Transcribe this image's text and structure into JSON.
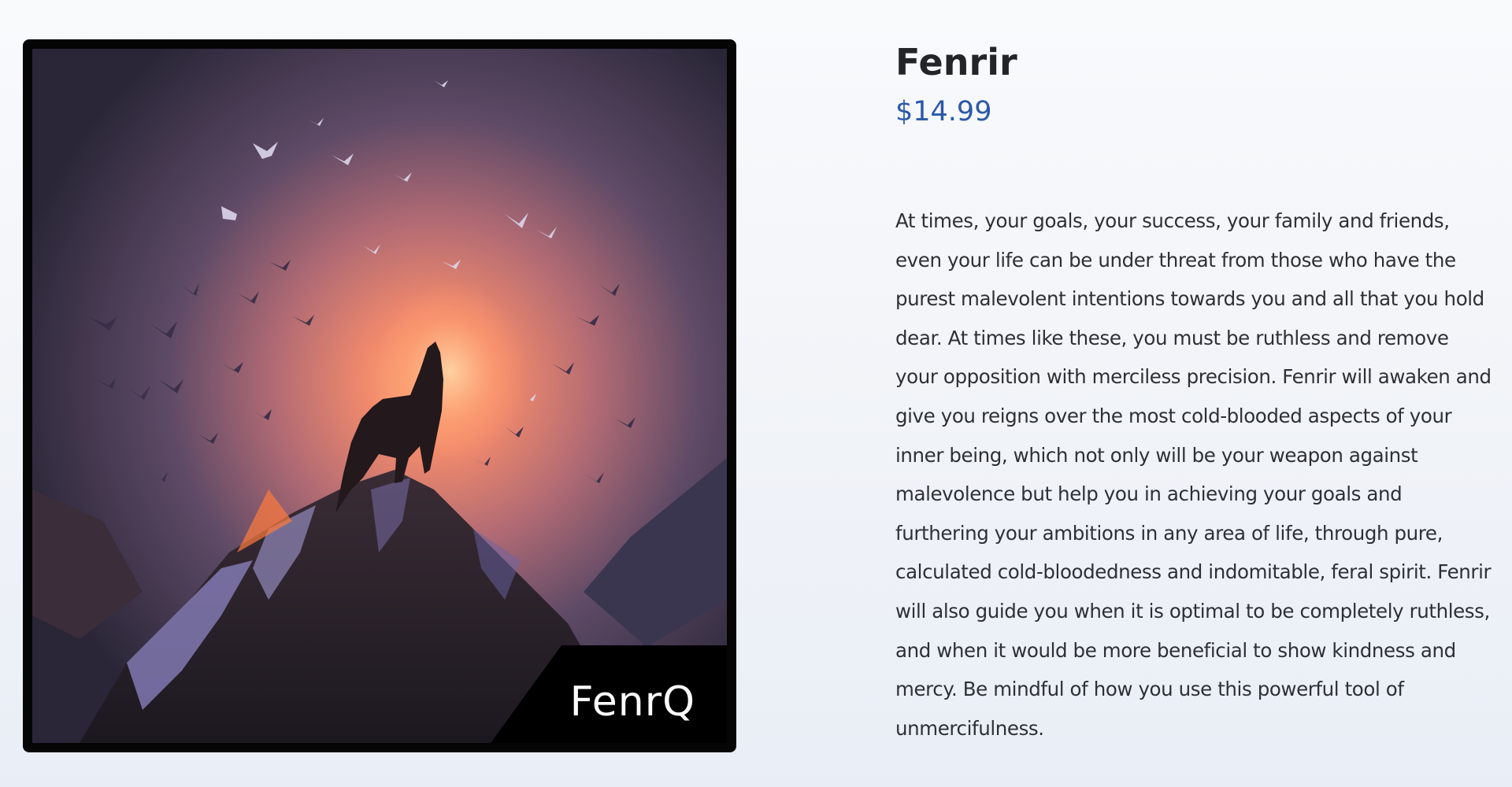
{
  "product": {
    "title": "Fenrir",
    "price": "$14.99",
    "description": "At times, your goals, your success, your family and friends, even your life can be under threat from those who have the purest malevolent intentions towards you and all that you hold dear. At times like these, you must be ruthless and remove your opposition with merciless precision. Fenrir will awaken and give you reigns over the most cold-blooded aspects of your inner being, which not only will be your weapon against malevolence but help you in achieving your goals and furthering your ambitions in any area of life, through pure, calculated cold-bloodedness and indomitable, feral spirit. Fenrir will also guide you when it is optimal to be completely ruthless, and when it would be more beneficial to show kindness and mercy. Be mindful of how you use this powerful tool of unmercifulness."
  },
  "image": {
    "brand_label": "FenrQ"
  },
  "colors": {
    "price": "#2a59a9",
    "title": "#222427",
    "text": "#2d3035",
    "frame": "#050506"
  }
}
